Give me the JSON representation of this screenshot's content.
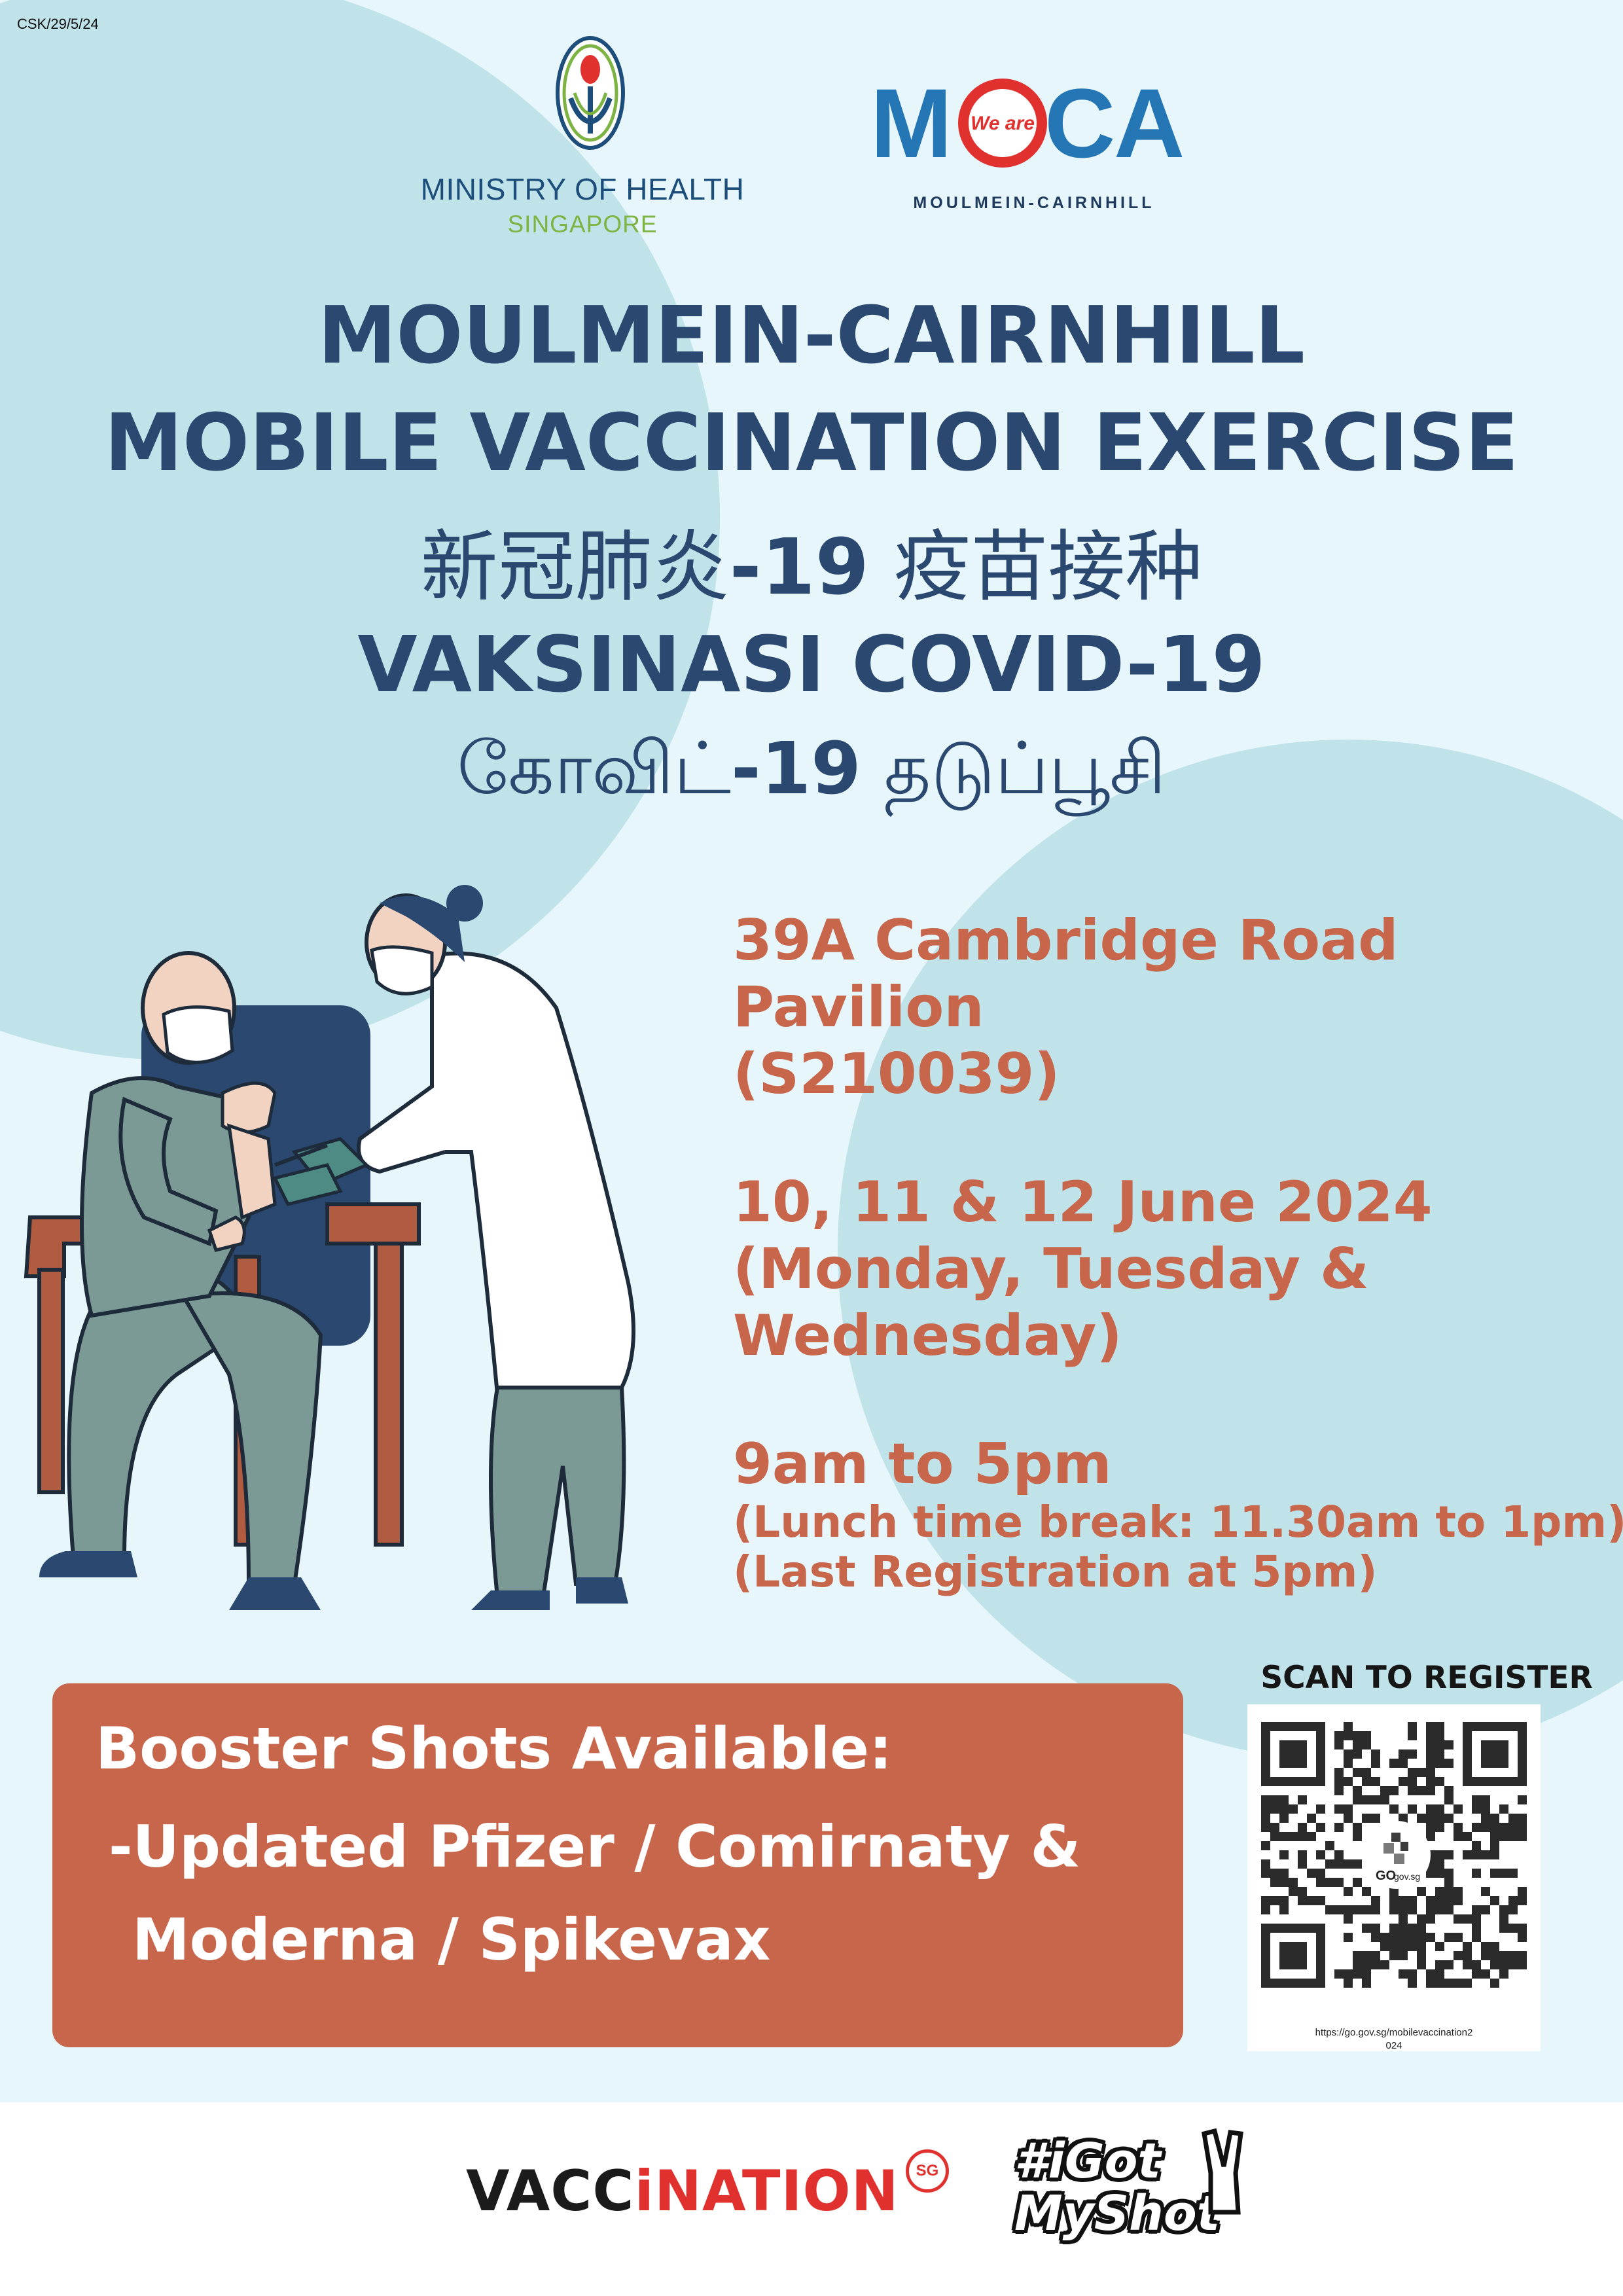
{
  "header": {
    "doc_code": "CSK/29/5/24",
    "moh_line1": "MINISTRY OF HEALTH",
    "moh_line2": "SINGAPORE",
    "moca_tag": "We are",
    "moca_letters": [
      "M",
      "C",
      "A"
    ],
    "moca_subtitle": "MOULMEIN-CAIRNHILL"
  },
  "titles": {
    "line1": "MOULMEIN-CAIRNHILL",
    "line2": "MOBILE VACCINATION EXERCISE",
    "chinese_a": "新冠肺炎",
    "chinese_b": "-19",
    "chinese_c": " 疫苗接种",
    "malay": "VAKSINASI COVID-19",
    "tamil_a": "கோவிட்",
    "tamil_b": "-19",
    "tamil_c": " தடுப்பூசி"
  },
  "venue": {
    "line1": "39A Cambridge Road",
    "line2": "Pavilion",
    "postal": "(S210039)"
  },
  "dates": {
    "line1": "10, 11 & 12 June 2024",
    "line2": "(Monday, Tuesday &",
    "line3": "Wednesday)"
  },
  "time": {
    "hours": "9am to 5pm",
    "lunch": "(Lunch time break: 11.30am to 1pm)",
    "last_registration": "(Last Registration at 5pm)"
  },
  "booster": {
    "title": "Booster Shots Available:",
    "line1": "-Updated Pfizer / Comirnaty &",
    "line2": "Moderna / Spikevax"
  },
  "qr": {
    "heading": "SCAN TO REGISTER",
    "badge_go": "GO",
    "badge_domain": "gov.sg",
    "url_line1": "https://go.gov.sg/mobilevaccination2",
    "url_line2": "024"
  },
  "footer": {
    "vacc_a": "VACC",
    "vacc_b": "i",
    "vacc_c": "NATION",
    "sg": "SG",
    "hashtag_line1": "#iGot",
    "hashtag_line2": "MyShot"
  },
  "colors": {
    "background": "#e6f6fb",
    "circle": "#c0e2e9",
    "title_navy": "#2a4870",
    "info_orange": "#c8664c",
    "booster_box": "#c8664c",
    "moca_red": "#e0312f",
    "moca_blue": "#2576b4",
    "moh_green": "#7cb342"
  }
}
